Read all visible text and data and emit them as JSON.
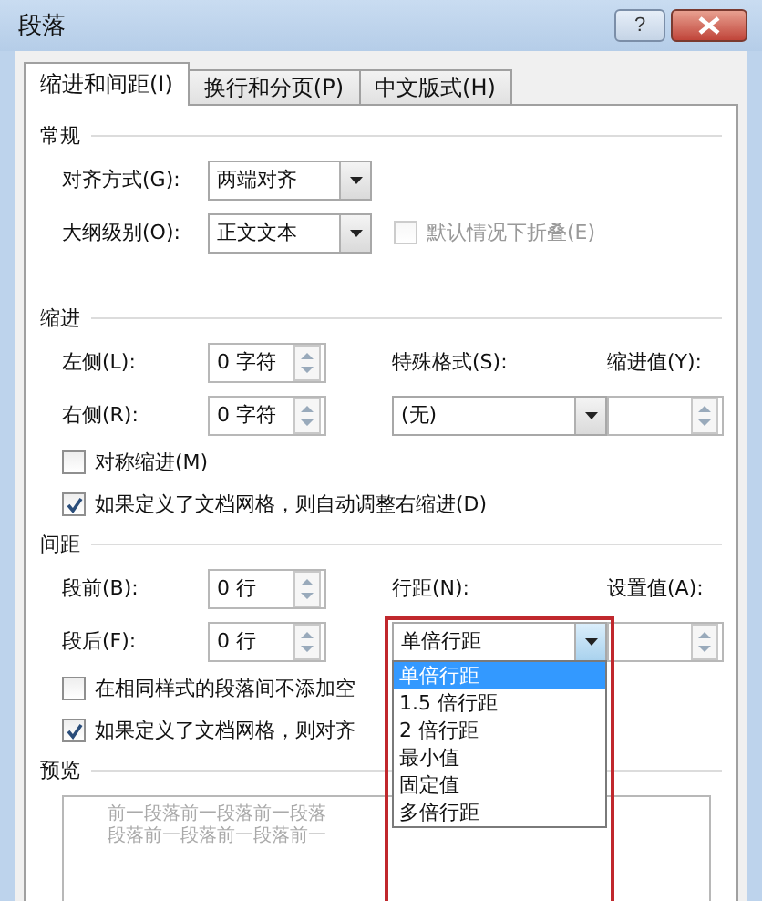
{
  "window": {
    "title": "段落",
    "help": "?"
  },
  "tabs": [
    {
      "label": "缩进和间距(I)",
      "selected": true
    },
    {
      "label": "换行和分页(P)",
      "selected": false
    },
    {
      "label": "中文版式(H)",
      "selected": false
    }
  ],
  "general": {
    "heading": "常规",
    "alignment": {
      "label": "对齐方式(G):",
      "value": "两端对齐"
    },
    "outline_level": {
      "label": "大纲级别(O):",
      "value": "正文文本"
    },
    "collapse": {
      "label": "默认情况下折叠(E)",
      "checked": false,
      "disabled": true
    }
  },
  "indent": {
    "heading": "缩进",
    "left": {
      "label": "左侧(L):",
      "value": "0 字符"
    },
    "right": {
      "label": "右侧(R):",
      "value": "0 字符"
    },
    "special": {
      "label": "特殊格式(S):",
      "value": "(无)"
    },
    "by": {
      "label": "缩进值(Y):"
    },
    "checkboxes": [
      {
        "label": "对称缩进(M)",
        "checked": false
      },
      {
        "label": "如果定义了文档网格，则自动调整右缩进(D)",
        "checked": true
      }
    ]
  },
  "spacing": {
    "heading": "间距",
    "before": {
      "label": "段前(B):",
      "value": "0 行"
    },
    "after": {
      "label": "段后(F):",
      "value": "0 行"
    },
    "line": {
      "label": "行距(N):",
      "value": "单倍行距",
      "expanded": true,
      "highlighted": true,
      "options": [
        {
          "label": "单倍行距",
          "selected": true
        },
        {
          "label": "1.5 倍行距",
          "selected": false
        },
        {
          "label": "2 倍行距",
          "selected": false
        },
        {
          "label": "最小值",
          "selected": false
        },
        {
          "label": "固定值",
          "selected": false
        },
        {
          "label": "多倍行距",
          "selected": false
        }
      ]
    },
    "at": {
      "label": "设置值(A):"
    },
    "checkboxes": [
      {
        "label": "在相同样式的段落间不添加空",
        "checked": false
      },
      {
        "label": "如果定义了文档网格，则对齐",
        "checked": true
      }
    ]
  },
  "preview": {
    "heading": "预览",
    "lines": [
      "前一段落前一段落前一段落",
      "段落前一段落前一段落前一"
    ]
  }
}
